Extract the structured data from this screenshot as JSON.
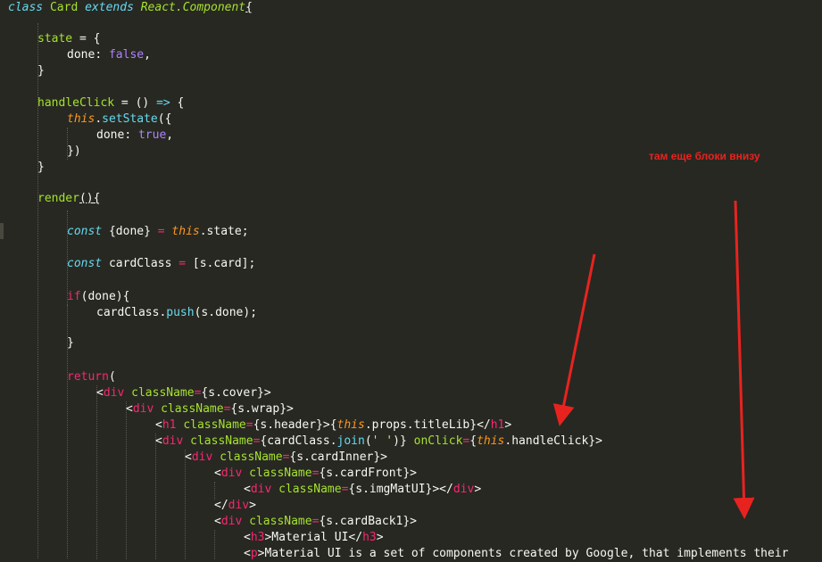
{
  "code": {
    "l1": [
      "class",
      " ",
      "Card",
      " ",
      "extends",
      " ",
      "React.Component",
      "{"
    ],
    "l2": [
      "state",
      " = {"
    ],
    "l3": [
      "done",
      ": ",
      "false",
      ","
    ],
    "l4": [
      "}"
    ],
    "l5": [
      "handleClick",
      " = () ",
      "=>",
      " {"
    ],
    "l6": [
      "this",
      ".",
      "setState",
      "({"
    ],
    "l7": [
      "done",
      ": ",
      "true",
      ","
    ],
    "l8": [
      "})"
    ],
    "l9": [
      "}"
    ],
    "l10": [
      "render",
      "(){"
    ],
    "l11": [
      "const",
      " {done} ",
      "=",
      " ",
      "this",
      ".state;"
    ],
    "l12": [
      "const",
      " cardClass ",
      "=",
      " [s.card];"
    ],
    "l13": [
      "if",
      "(done){"
    ],
    "l14": [
      "cardClass.",
      "push",
      "(s.done);"
    ],
    "l15": [
      "}"
    ],
    "l16": [
      "return",
      "("
    ],
    "l17": [
      "<",
      "div",
      " ",
      "className",
      "=",
      "{s.cover}",
      ">"
    ],
    "l18": [
      "<",
      "div",
      " ",
      "className",
      "=",
      "{s.wrap}",
      ">"
    ],
    "l19": [
      "<",
      "h1",
      " ",
      "className",
      "=",
      "{s.header}",
      ">",
      "{",
      "this",
      ".props.titleLib}",
      "</",
      "h1",
      ">"
    ],
    "l20": [
      "<",
      "div",
      " ",
      "className",
      "=",
      "{cardClass.",
      "join",
      "(",
      "' '",
      ")}",
      " ",
      "onClick",
      "=",
      "{",
      "this",
      ".handleClick}",
      ">"
    ],
    "l21": [
      "<",
      "div",
      " ",
      "className",
      "=",
      "{s.cardInner}",
      ">"
    ],
    "l22": [
      "<",
      "div",
      " ",
      "className",
      "=",
      "{s.cardFront}",
      ">"
    ],
    "l23": [
      "<",
      "div",
      " ",
      "className",
      "=",
      "{s.imgMatUI}",
      "></",
      "div",
      ">"
    ],
    "l24": [
      "</",
      "div",
      ">"
    ],
    "l25": [
      "<",
      "div",
      " ",
      "className",
      "=",
      "{s.cardBack1}",
      ">"
    ],
    "l26": [
      "<",
      "h3",
      ">Material UI</",
      "h3",
      ">"
    ],
    "l27": [
      "<",
      "p",
      ">Material UI is a set of components created by Google, that implements their"
    ]
  },
  "annotation": {
    "text": "там еще блоки внизу",
    "color": "#e8231f"
  },
  "theme": {
    "background": "#272822",
    "keyword": "#f92672",
    "storage": "#66d9ef",
    "entity": "#a6e22e",
    "constant": "#ae81ff",
    "string": "#e6db74",
    "this": "#fd971f"
  }
}
